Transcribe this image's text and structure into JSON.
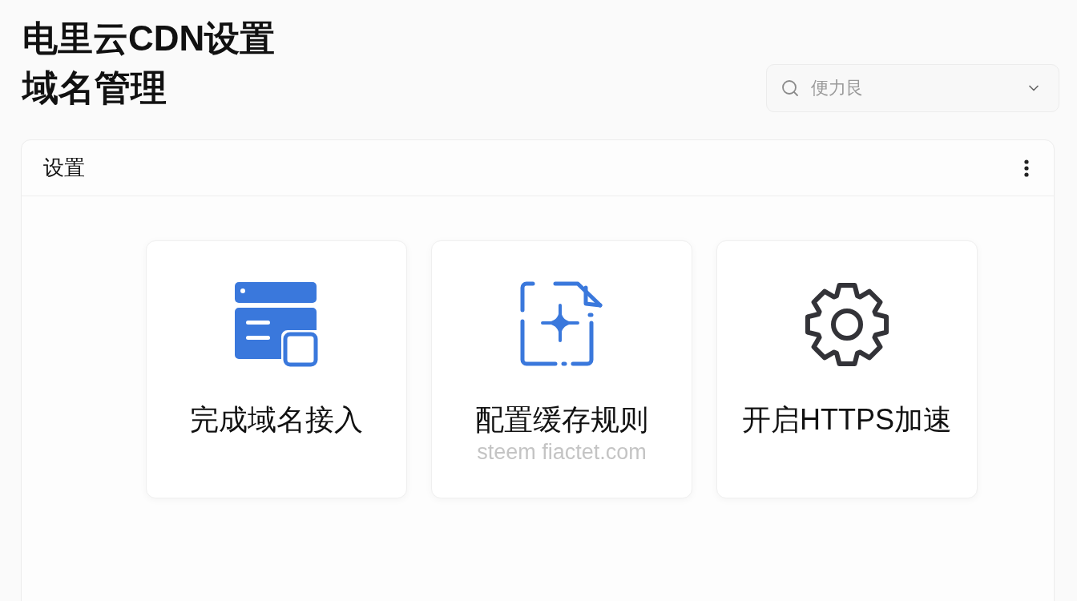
{
  "header": {
    "title": "电里云CDN设置",
    "subtitle": "域名管理"
  },
  "search": {
    "placeholder": "便力艮"
  },
  "panel": {
    "title": "设置",
    "cards": [
      {
        "kind": "domain",
        "title": "完成域名接入"
      },
      {
        "kind": "cache",
        "title": "配置缓存规则",
        "subtitle": "steem fiactet.com"
      },
      {
        "kind": "gear",
        "title": "开启HTTPS加速"
      }
    ]
  }
}
